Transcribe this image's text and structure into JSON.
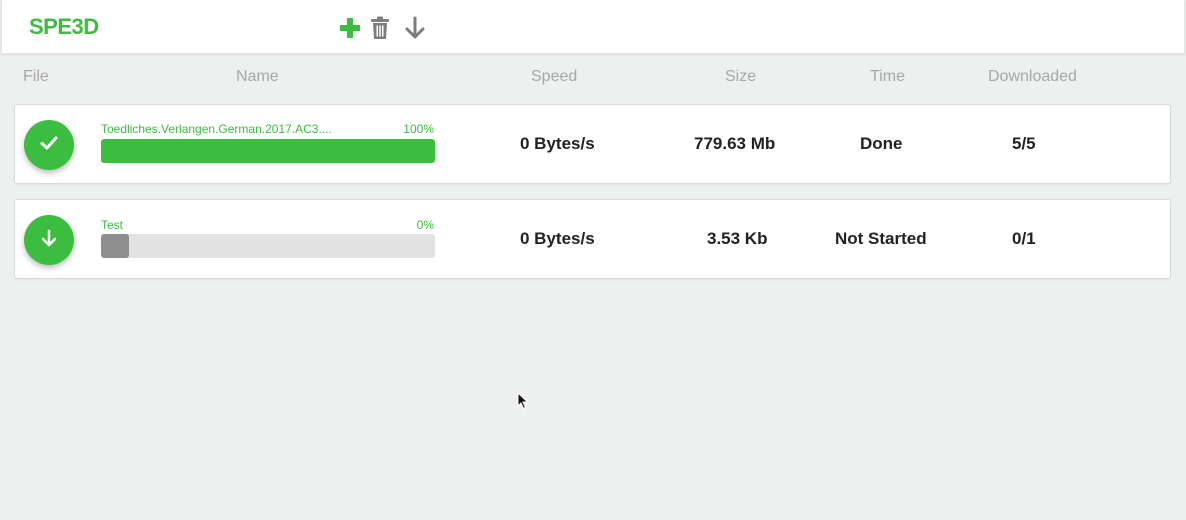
{
  "app": {
    "title": "SPE3D",
    "brand_color": "#3bbd3f"
  },
  "toolbar": {
    "add_icon": "plus-icon",
    "delete_icon": "trash-icon",
    "download_icon": "arrow-down-icon"
  },
  "columns": {
    "file": "File",
    "name": "Name",
    "speed": "Speed",
    "size": "Size",
    "time": "Time",
    "downloaded": "Downloaded"
  },
  "downloads": [
    {
      "status_icon": "checkmark-icon",
      "name": "Toedliches.Verlangen.German.2017.AC3....",
      "percent_label": "100%",
      "progress": 1.0,
      "progress_color": "#3bbd3f",
      "speed": "0 Bytes/s",
      "size": "779.63 Mb",
      "time": "Done",
      "downloaded": "5/5"
    },
    {
      "status_icon": "arrow-down-icon",
      "name": "Test",
      "percent_label": "0%",
      "progress": 0.0,
      "progress_color": "#8e8e8e",
      "speed": "0 Bytes/s",
      "size": "3.53 Kb",
      "time": "Not Started",
      "downloaded": "0/1"
    }
  ]
}
